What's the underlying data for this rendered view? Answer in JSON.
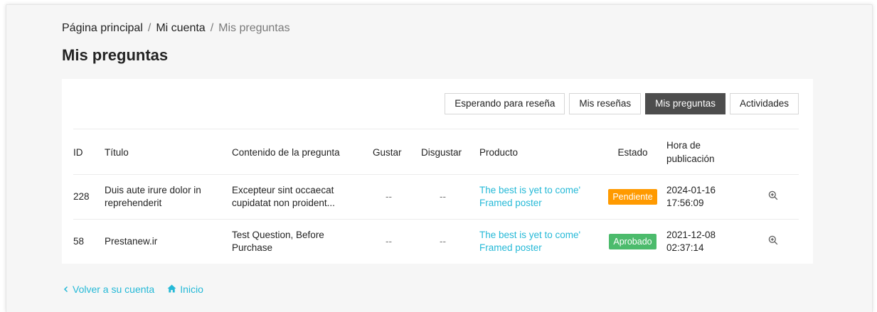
{
  "breadcrumb": {
    "items": [
      "Página principal",
      "Mi cuenta"
    ],
    "separator": "/",
    "current": "Mis preguntas"
  },
  "page_title": "Mis preguntas",
  "tabs": [
    {
      "label": "Esperando para reseña",
      "active": false
    },
    {
      "label": "Mis reseñas",
      "active": false
    },
    {
      "label": "Mis preguntas",
      "active": true
    },
    {
      "label": "Actividades",
      "active": false
    }
  ],
  "table": {
    "headers": {
      "id": "ID",
      "title": "Título",
      "content": "Contenido de la pregunta",
      "like": "Gustar",
      "dislike": "Disgustar",
      "product": "Producto",
      "status": "Estado",
      "time_line1": "Hora de",
      "time_line2": "publicación"
    },
    "rows": [
      {
        "id": "228",
        "title_line1": "Duis aute irure dolor in",
        "title_line2": "reprehenderit",
        "content_line1": "Excepteur sint occaecat",
        "content_line2": "cupidatat non proident...",
        "like": "--",
        "dislike": "--",
        "product_line1": "The best is yet to come'",
        "product_line2": "Framed poster",
        "status": "Pendiente",
        "status_color": "#ff9a00",
        "date": "2024-01-16",
        "time": "17:56:09",
        "action_icon": "zoom-in-icon"
      },
      {
        "id": "58",
        "title_line1": "Prestanew.ir",
        "title_line2": "",
        "content_line1": "Test Question, Before",
        "content_line2": "Purchase",
        "like": "--",
        "dislike": "--",
        "product_line1": "The best is yet to come'",
        "product_line2": "Framed poster",
        "status": "Aprobado",
        "status_color": "#4cbb6c",
        "date": "2021-12-08",
        "time": "02:37:14",
        "action_icon": "zoom-in-icon"
      }
    ]
  },
  "footer": {
    "back_label": "Volver a su cuenta",
    "back_icon": "chevron-left-icon",
    "home_label": "Inicio",
    "home_icon": "home-icon"
  },
  "colors": {
    "accent": "#25b9d7",
    "active_tab": "#4d4d4d",
    "pending": "#ff9a00",
    "approved": "#4cbb6c"
  }
}
